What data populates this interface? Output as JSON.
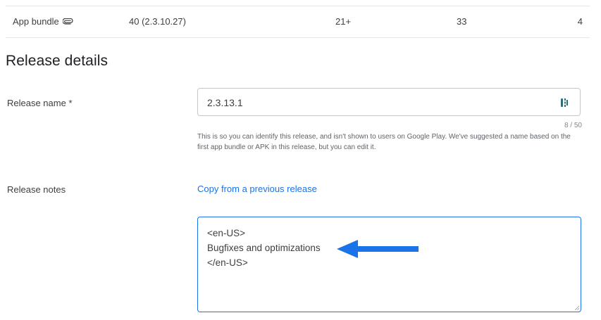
{
  "bundle_row": {
    "type_label": "App bundle",
    "type_icon": "attachment-icon",
    "version": "40 (2.3.10.27)",
    "min_sdk": "21+",
    "target_sdk": "33",
    "count": "4"
  },
  "section": {
    "title": "Release details"
  },
  "release_name": {
    "label": "Release name  *",
    "value": "2.3.13.1",
    "counter": "8 / 50",
    "helper": "This is so you can identify this release, and isn't shown to users on Google Play. We've suggested a name based on the first app bundle or APK in this release, but you can edit it.",
    "icon": "password-manager-icon"
  },
  "release_notes": {
    "label": "Release notes",
    "copy_link": "Copy from a previous release",
    "value": "<en-US>\nBugfixes and optimizations\n</en-US>"
  },
  "colors": {
    "accent": "#1a73e8",
    "arrow": "#1a73e8"
  }
}
